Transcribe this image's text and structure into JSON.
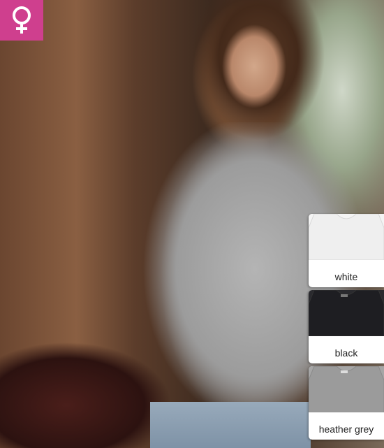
{
  "badge": {
    "icon": "female-symbol-icon",
    "color": "#cf3f8e"
  },
  "hero": {
    "description_icon": "product-photo"
  },
  "swatches": [
    {
      "label": "white",
      "shirt_color": "#efefef",
      "bg": "#f4f4f4"
    },
    {
      "label": "black",
      "shirt_color": "#1e1e22",
      "bg": "#2a2a2e"
    },
    {
      "label": "heather grey",
      "shirt_color": "#9b9b9b",
      "bg": "#a6a6a6"
    }
  ]
}
